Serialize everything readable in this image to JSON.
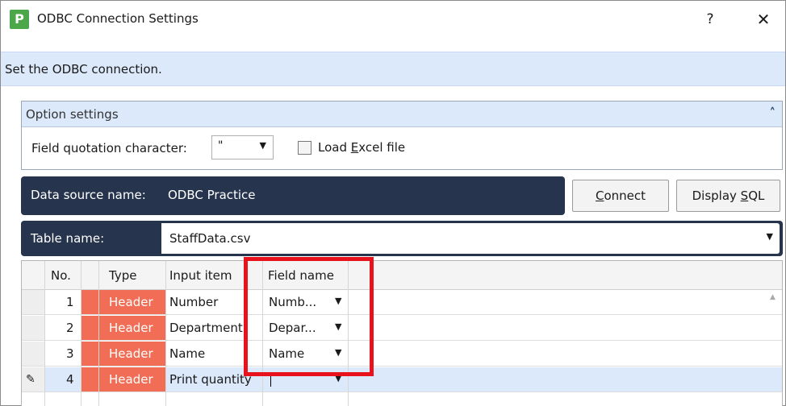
{
  "window": {
    "app_icon": "P",
    "title": "ODBC Connection Settings",
    "help": "?",
    "close": "✕"
  },
  "instruction": "Set the ODBC connection.",
  "options": {
    "header": "Option settings",
    "collapse_icon": "chevron-double-up-icon",
    "field_quotation_label": "Field quotation character:",
    "field_quotation_value": "\"",
    "load_excel_label_pre": "Load ",
    "load_excel_label_u": "E",
    "load_excel_label_post": "xcel file",
    "load_excel_checked": false
  },
  "datasource": {
    "label": "Data source name:",
    "value": "ODBC Practice",
    "connect_u": "C",
    "connect_rest": "onnect",
    "display_sql_pre": "Display ",
    "display_sql_u": "S",
    "display_sql_post": "QL"
  },
  "table": {
    "label": "Table name:",
    "value": "StaffData.csv"
  },
  "grid": {
    "columns": [
      "No.",
      "Type",
      "Input item",
      "Field name"
    ],
    "rows": [
      {
        "no": "1",
        "type": "Header",
        "input": "Number",
        "field": "Numb..."
      },
      {
        "no": "2",
        "type": "Header",
        "input": "Department",
        "field": "Depar..."
      },
      {
        "no": "3",
        "type": "Header",
        "input": "Name",
        "field": "Name"
      },
      {
        "no": "4",
        "type": "Header",
        "input": "Print quantity",
        "field": ""
      }
    ]
  },
  "colors": {
    "header_bar": "#27344e",
    "type_cell": "#f26d55",
    "highlight_box": "#e8121d",
    "band": "#dce9fb"
  }
}
